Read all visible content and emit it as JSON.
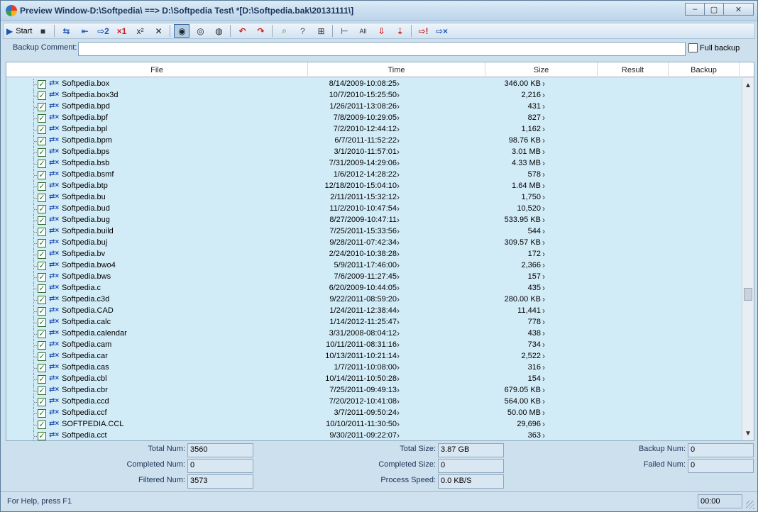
{
  "window": {
    "title": "Preview Window-D:\\Softpedia\\ ==> D:\\Softpedia Test\\ *[D:\\Softpedia.bak\\20131111\\]",
    "minimize": "‒",
    "maximize": "▢",
    "close": "✕"
  },
  "toolbar": {
    "start_label": "Start",
    "buttons": [
      {
        "name": "start-icon",
        "glyph": "▶"
      },
      {
        "name": "stop-icon",
        "glyph": "■"
      },
      {
        "name": "swap-icon",
        "glyph": "⇆"
      },
      {
        "name": "back-icon",
        "glyph": "⇤"
      },
      {
        "name": "forward-2-icon",
        "glyph": "⇨2"
      },
      {
        "name": "delete-1-icon",
        "glyph": "×1"
      },
      {
        "name": "x2-icon",
        "glyph": "x²"
      },
      {
        "name": "x-icon",
        "glyph": "✕"
      },
      {
        "name": "view-icon",
        "glyph": "◉"
      },
      {
        "name": "view-all-icon",
        "glyph": "◎"
      },
      {
        "name": "view-filter-icon",
        "glyph": "◍"
      },
      {
        "name": "undo-red-icon",
        "glyph": "↶"
      },
      {
        "name": "redo-red-icon",
        "glyph": "↷"
      },
      {
        "name": "search-icon",
        "glyph": "⌕"
      },
      {
        "name": "question-search-icon",
        "glyph": "?"
      },
      {
        "name": "filter-icon",
        "glyph": "⊞"
      },
      {
        "name": "tree-icon",
        "glyph": "⊢"
      },
      {
        "name": "select-all-icon",
        "glyph": "All"
      },
      {
        "name": "move-down-icon",
        "glyph": "⇩"
      },
      {
        "name": "move-down-2-icon",
        "glyph": "⇣"
      },
      {
        "name": "alert-icon",
        "glyph": "⇨!"
      },
      {
        "name": "cancel-arrow-icon",
        "glyph": "⇨×"
      }
    ]
  },
  "comment": {
    "label": "Backup Comment:",
    "value": "",
    "full_backup_label": "Full backup"
  },
  "grid": {
    "columns": [
      "File",
      "Time",
      "Size",
      "Result",
      "Backup"
    ],
    "rows": [
      {
        "file": "Softpedia.box",
        "time": "8/14/2009-10:08:25",
        "size": "346.00 KB"
      },
      {
        "file": "Softpedia.box3d",
        "time": "10/7/2010-15:25:50",
        "size": "2,216"
      },
      {
        "file": "Softpedia.bpd",
        "time": "1/26/2011-13:08:26",
        "size": "431"
      },
      {
        "file": "Softpedia.bpf",
        "time": "7/8/2009-10:29:05",
        "size": "827"
      },
      {
        "file": "Softpedia.bpl",
        "time": "7/2/2010-12:44:12",
        "size": "1,162"
      },
      {
        "file": "Softpedia.bpm",
        "time": "6/7/2011-11:52:22",
        "size": "98.76 KB"
      },
      {
        "file": "Softpedia.bps",
        "time": "3/1/2010-11:57:01",
        "size": "3.01 MB"
      },
      {
        "file": "Softpedia.bsb",
        "time": "7/31/2009-14:29:06",
        "size": "4.33 MB"
      },
      {
        "file": "Softpedia.bsmf",
        "time": "1/6/2012-14:28:22",
        "size": "578"
      },
      {
        "file": "Softpedia.btp",
        "time": "12/18/2010-15:04:10",
        "size": "1.64 MB"
      },
      {
        "file": "Softpedia.bu",
        "time": "2/11/2011-15:32:12",
        "size": "1,750"
      },
      {
        "file": "Softpedia.bud",
        "time": "11/2/2010-10:47:54",
        "size": "10,520"
      },
      {
        "file": "Softpedia.bug",
        "time": "8/27/2009-10:47:11",
        "size": "533.95 KB"
      },
      {
        "file": "Softpedia.build",
        "time": "7/25/2011-15:33:56",
        "size": "544"
      },
      {
        "file": "Softpedia.buj",
        "time": "9/28/2011-07:42:34",
        "size": "309.57 KB"
      },
      {
        "file": "Softpedia.bv",
        "time": "2/24/2010-10:38:28",
        "size": "172"
      },
      {
        "file": "Softpedia.bwo4",
        "time": "5/9/2011-17:46:00",
        "size": "2,366"
      },
      {
        "file": "Softpedia.bws",
        "time": "7/6/2009-11:27:45",
        "size": "157"
      },
      {
        "file": "Softpedia.c",
        "time": "6/20/2009-10:44:05",
        "size": "435"
      },
      {
        "file": "Softpedia.c3d",
        "time": "9/22/2011-08:59:20",
        "size": "280.00 KB"
      },
      {
        "file": "Softpedia.CAD",
        "time": "1/24/2011-12:38:44",
        "size": "11,441"
      },
      {
        "file": "Softpedia.calc",
        "time": "1/14/2012-11:25:47",
        "size": "778"
      },
      {
        "file": "Softpedia.calendar",
        "time": "3/31/2008-08:04:12",
        "size": "438"
      },
      {
        "file": "Softpedia.cam",
        "time": "10/11/2011-08:31:16",
        "size": "734"
      },
      {
        "file": "Softpedia.car",
        "time": "10/13/2011-10:21:14",
        "size": "2,522"
      },
      {
        "file": "Softpedia.cas",
        "time": "1/7/2011-10:08:00",
        "size": "316"
      },
      {
        "file": "Softpedia.cbl",
        "time": "10/14/2011-10:50:28",
        "size": "154"
      },
      {
        "file": "Softpedia.cbr",
        "time": "7/25/2011-09:49:13",
        "size": "679.05 KB"
      },
      {
        "file": "Softpedia.ccd",
        "time": "7/20/2012-10:41:08",
        "size": "564.00 KB"
      },
      {
        "file": "Softpedia.ccf",
        "time": "3/7/2011-09:50:24",
        "size": "50.00 MB"
      },
      {
        "file": "SOFTPEDIA.CCL",
        "time": "10/10/2011-11:30:50",
        "size": "29,696"
      },
      {
        "file": "Softpedia.cct",
        "time": "9/30/2011-09:22:07",
        "size": "363"
      }
    ]
  },
  "stats": {
    "total_num_label": "Total Num:",
    "total_num": "3560",
    "completed_num_label": "Completed Num:",
    "completed_num": "0",
    "filtered_num_label": "Filtered Num:",
    "filtered_num": "3573",
    "total_size_label": "Total Size:",
    "total_size": "3.87 GB",
    "completed_size_label": "Completed Size:",
    "completed_size": "0",
    "process_speed_label": "Process Speed:",
    "process_speed": "0.0 KB/S",
    "backup_num_label": "Backup Num:",
    "backup_num": "0",
    "failed_num_label": "Failed Num:",
    "failed_num": "0"
  },
  "statusbar": {
    "help": "For Help, press F1",
    "time": "00:00"
  }
}
